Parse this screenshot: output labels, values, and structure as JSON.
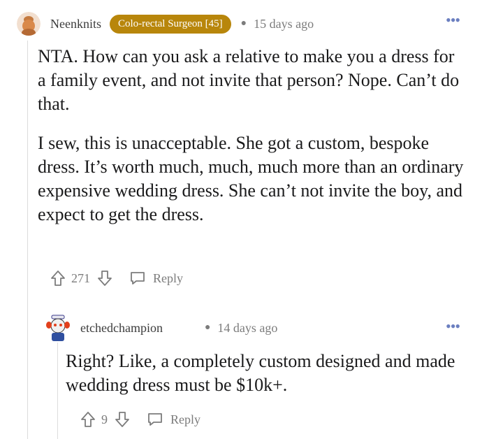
{
  "comments": [
    {
      "username": "Neenknits",
      "flair": "Colo-rectal Surgeon [45]",
      "time": "15 days ago",
      "paragraphs": [
        "NTA. How can you ask a relative to make you a dress for a family event, and not invite that person? Nope. Can’t do that.",
        "I sew, this is unacceptable. She got a custom, bespoke dress. It’s worth much, much, much more than an ordinary expensive wedding dress. She can’t not invite the boy, and expect to get the dress."
      ],
      "score": "271",
      "reply_label": "Reply"
    },
    {
      "username": "etchedchampion",
      "time": "14 days ago",
      "paragraphs": [
        "Right? Like, a completely custom designed and made wedding dress must be $10k+."
      ],
      "score": "9",
      "reply_label": "Reply"
    }
  ],
  "more_label": "•••",
  "colors": {
    "flair_bg": "#b8860b",
    "meta_gray": "#7c7c7c",
    "more_blue": "#6b7fc0",
    "thread_line": "#dcdcdc"
  },
  "icons": [
    "upvote-icon",
    "downvote-icon",
    "reply-icon",
    "more-options-icon"
  ]
}
